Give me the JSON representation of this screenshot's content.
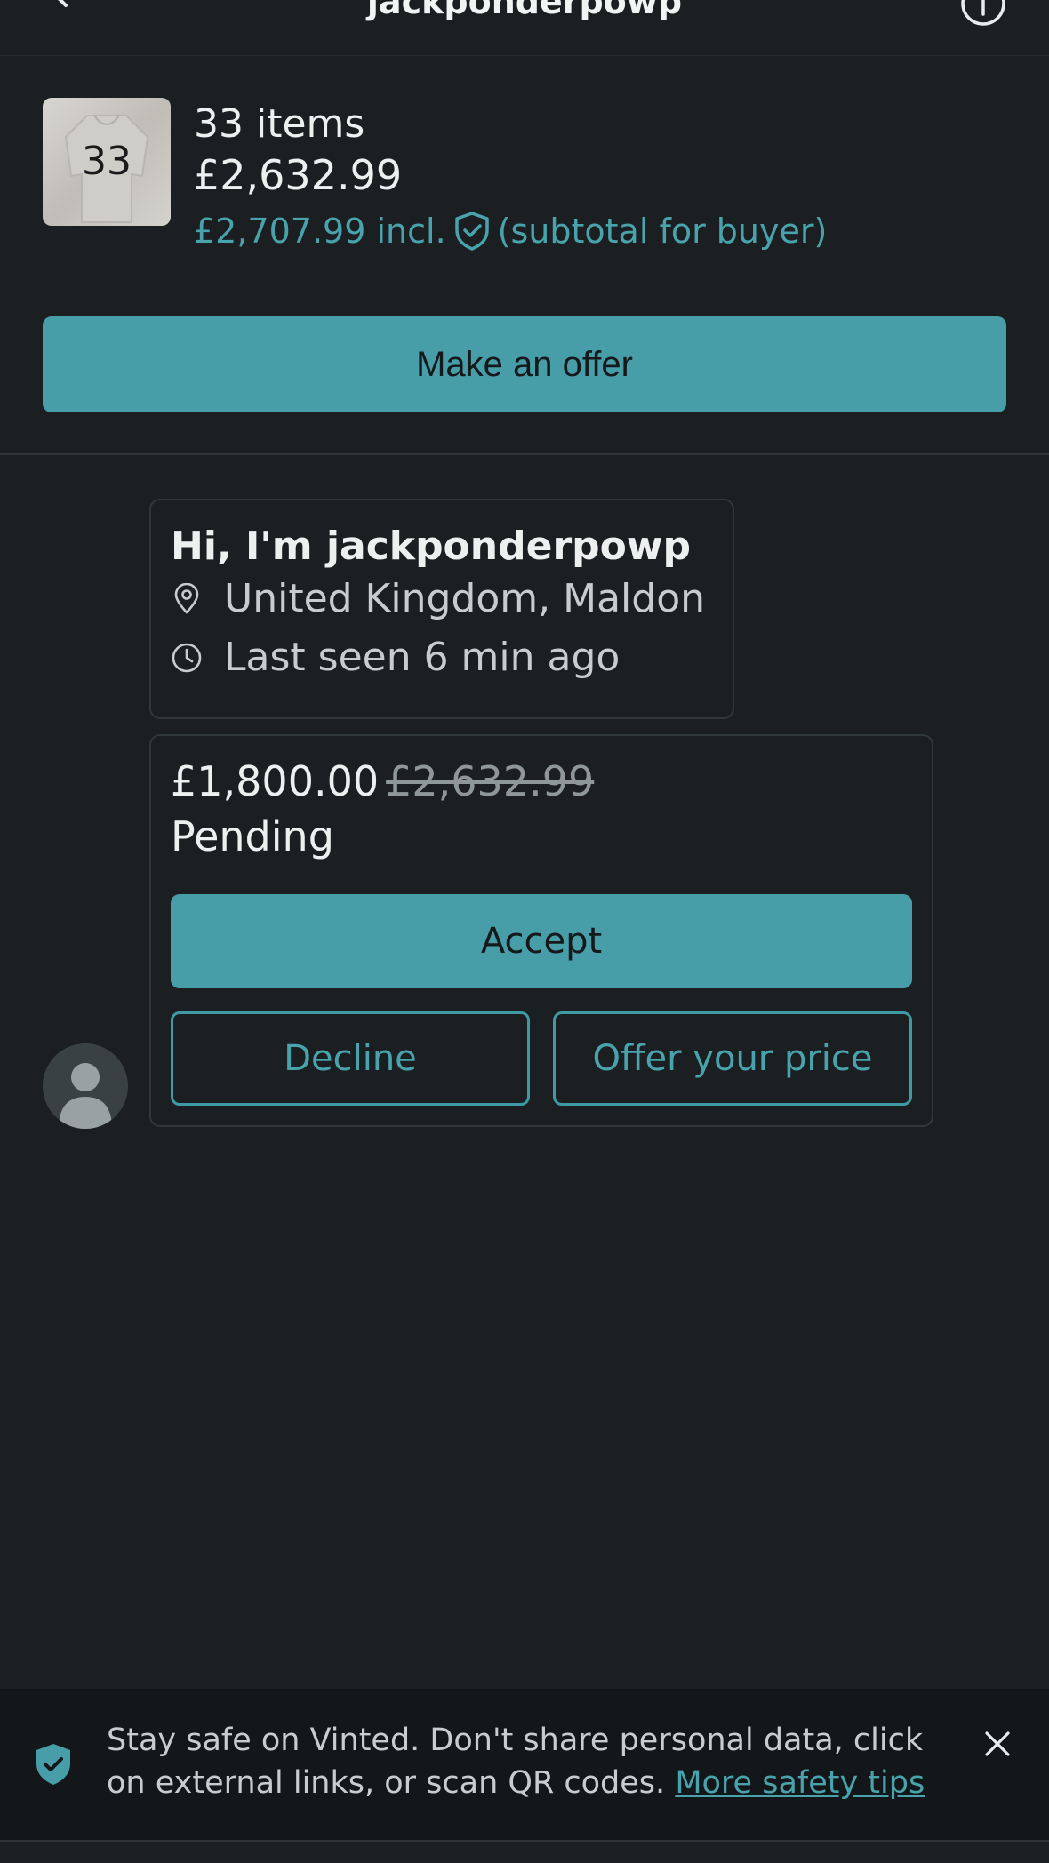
{
  "header": {
    "title": "jackponderpowp"
  },
  "item_summary": {
    "thumb_count": "33",
    "items_count": "33 items",
    "price": "£2,632.99",
    "buyer_price_prefix": "£2,707.99 incl.",
    "buyer_price_suffix": "(subtotal for buyer)"
  },
  "actions": {
    "make_offer": "Make an offer"
  },
  "profile": {
    "greeting": "Hi, I'm jackponderpowp",
    "location": "United Kingdom, Maldon",
    "last_seen": "Last seen 6 min ago"
  },
  "offer": {
    "new_price": "£1,800.00",
    "old_price": "£2,632.99",
    "status": "Pending",
    "accept": "Accept",
    "decline": "Decline",
    "counter": "Offer your price"
  },
  "safety": {
    "text": "Stay safe on Vinted. Don't share personal data, click on external links, or scan QR codes.",
    "link": "More safety tips"
  },
  "colors": {
    "accent": "#489ea8",
    "background": "#1b1f21"
  }
}
